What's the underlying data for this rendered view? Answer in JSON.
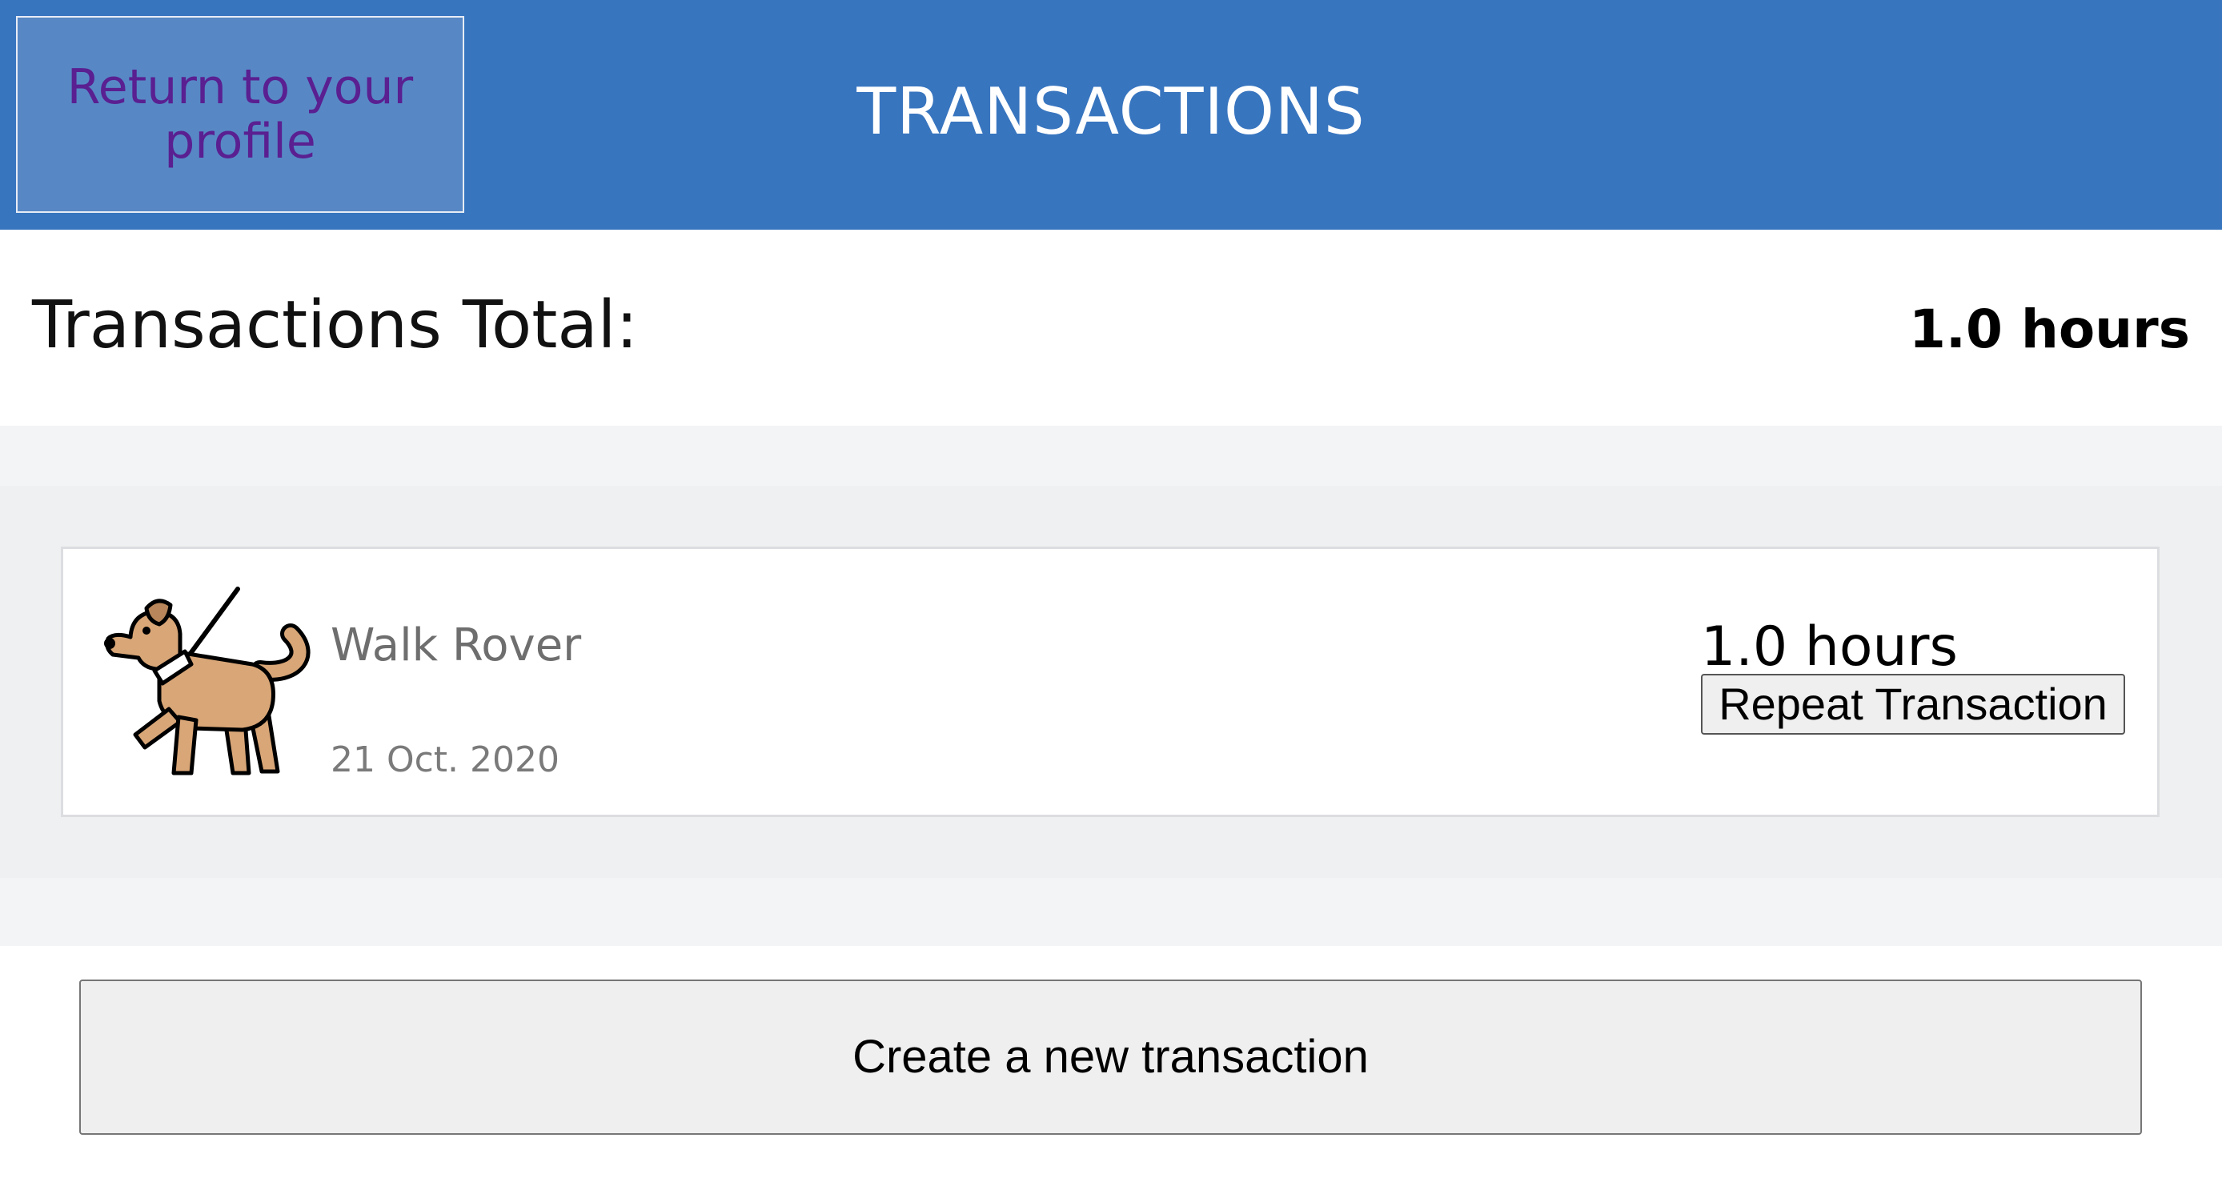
{
  "header": {
    "return_label": "Return to your profile",
    "title": "TRANSACTIONS"
  },
  "summary": {
    "total_label": "Transactions Total:",
    "total_value": "1.0 hours"
  },
  "transactions": [
    {
      "icon": "dog-walking-icon",
      "name": "Walk Rover",
      "date": "21 Oct. 2020",
      "hours": "1.0 hours",
      "repeat_label": "Repeat Transaction"
    }
  ],
  "actions": {
    "create_label": "Create a new transaction"
  },
  "colors": {
    "header_bg": "#3875bf",
    "return_button_bg": "#5788c5",
    "return_button_text": "#5a1f91",
    "dog_fill": "#d9a677"
  }
}
